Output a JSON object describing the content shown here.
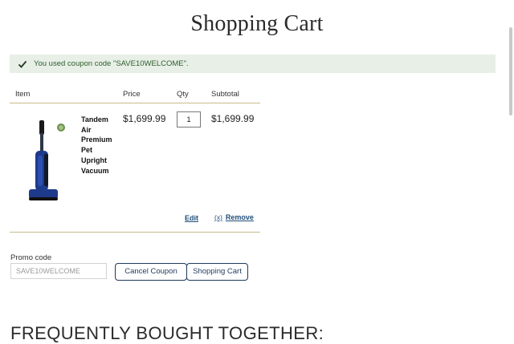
{
  "page": {
    "title": "Shopping Cart"
  },
  "notice": {
    "text": "You used coupon code \"SAVE10WELCOME\".",
    "color": "#2d5e2d",
    "background": "#e7efe6"
  },
  "table": {
    "headers": {
      "item": "Item",
      "price": "Price",
      "qty": "Qty",
      "subtotal": "Subtotal"
    },
    "rows": [
      {
        "name": "Tandem Air Premium Pet Upright Vacuum",
        "price": "$1,699.99",
        "qty": "1",
        "subtotal": "$1,699.99",
        "image_icon": "vacuum-icon"
      }
    ],
    "edit_label": "Edit",
    "remove_prefix": "(x)",
    "remove_label": "Remove"
  },
  "promo": {
    "label": "Promo code",
    "value": "SAVE10WELCOME",
    "cancel_button": "Cancel Coupon",
    "cart_button": "Shopping Cart"
  },
  "sections": {
    "frequently_bought": "FREQUENTLY BOUGHT TOGETHER:"
  },
  "colors": {
    "accent": "#1f3a5c",
    "rule": "#c8b98a",
    "link": "#1f4e79"
  }
}
